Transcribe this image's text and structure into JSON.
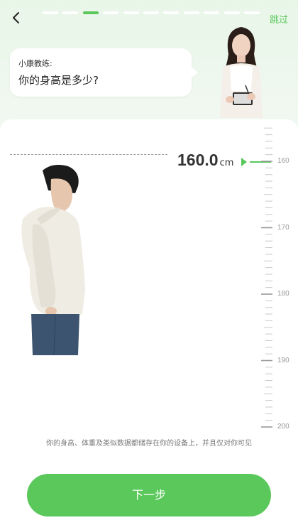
{
  "header": {
    "skip_label": "跳过",
    "progress": {
      "total": 11,
      "current": 3
    }
  },
  "coach": {
    "name": "小康教练:",
    "question": "你的身高是多少?"
  },
  "height": {
    "value": "160.0",
    "unit": "cm"
  },
  "ruler": {
    "labels": [
      "160",
      "170",
      "180",
      "190",
      "200"
    ]
  },
  "notice": "你的身高、体重及类似数据都储存在你的设备上，并且仅对你可见",
  "next_button": "下一步",
  "colors": {
    "accent": "#5ac85a",
    "bubble": "#ffffff",
    "card": "#ffffff"
  },
  "icons": [
    "back-icon",
    "pointer-icon",
    "coach-avatar",
    "person-figure"
  ]
}
